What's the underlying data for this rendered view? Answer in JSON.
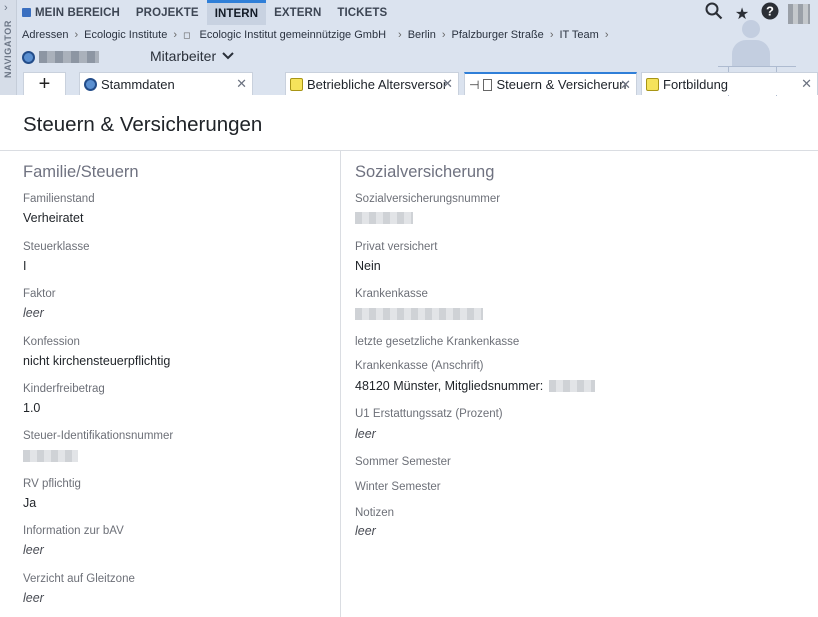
{
  "navigator": {
    "label": "NAVIGATOR"
  },
  "topnav": {
    "items": [
      {
        "label": "MEIN BEREICH"
      },
      {
        "label": "PROJEKTE"
      },
      {
        "label": "INTERN"
      },
      {
        "label": "EXTERN"
      },
      {
        "label": "TICKETS"
      }
    ]
  },
  "breadcrumb": [
    "Adressen",
    "Ecologic Institute",
    "Ecologic Institut gemeinnützige GmbH",
    "Berlin",
    "Pfalzburger Straße",
    "IT Team"
  ],
  "context": {
    "dropdown_label": "Mitarbeiter"
  },
  "tabs": [
    {
      "label": "Stammdaten"
    },
    {
      "label": "Betriebliche Altersversor"
    },
    {
      "label": "Steuern & Versicherun"
    },
    {
      "label": "Fortbildung"
    }
  ],
  "page": {
    "title": "Steuern & Versicherungen"
  },
  "left": {
    "heading": "Familie/Steuern",
    "fields": [
      {
        "label": "Familienstand",
        "value": "Verheiratet"
      },
      {
        "label": "Steuerklasse",
        "value": "I"
      },
      {
        "label": "Faktor",
        "value": "leer"
      },
      {
        "label": "Konfession",
        "value": "nicht kirchensteuerpflichtig"
      },
      {
        "label": "Kinderfreibetrag",
        "value": "1.0"
      },
      {
        "label": "Steuer-Identifikationsnummer",
        "value": ""
      },
      {
        "label": "RV pflichtig",
        "value": "Ja"
      },
      {
        "label": "Information zur bAV",
        "value": "leer"
      },
      {
        "label": "Verzicht auf Gleitzone",
        "value": "leer"
      }
    ]
  },
  "right": {
    "heading": "Sozialversicherung",
    "fields": [
      {
        "label": "Sozialversicherungsnummer",
        "value": ""
      },
      {
        "label": "Privat versichert",
        "value": "Nein"
      },
      {
        "label": "Krankenkasse",
        "value": ""
      },
      {
        "label": "letzte gesetzliche Krankenkasse",
        "value": ""
      },
      {
        "label": "Krankenkasse (Anschrift)",
        "value": "48120 Münster, Mitgliedsnummer:"
      },
      {
        "label": "U1 Erstattungssatz (Prozent)",
        "value": "leer"
      },
      {
        "label": "Sommer Semester",
        "value": ""
      },
      {
        "label": "Winter Semester",
        "value": ""
      },
      {
        "label": "Notizen",
        "value": "leer"
      }
    ]
  },
  "colors": {
    "accent": "#2f7fd8",
    "header_bg": "#dbe3ef"
  },
  "icons": [
    "search-icon",
    "star-icon",
    "help-icon",
    "user-avatar-icon",
    "plus-icon",
    "close-icon",
    "pin-icon",
    "note-icon",
    "person-icon",
    "chevron-down-icon",
    "chevron-right-icon"
  ]
}
